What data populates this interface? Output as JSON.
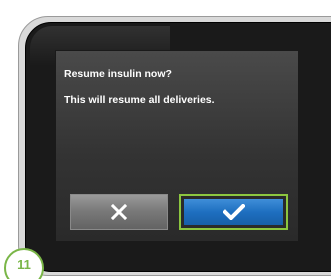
{
  "dialog": {
    "title": "Resume insulin now?",
    "message": "This will resume all deliveries."
  },
  "buttons": {
    "cancel_icon": "close-icon",
    "confirm_icon": "checkmark-icon"
  },
  "step": {
    "number": "11"
  },
  "colors": {
    "confirm_button": "#1e6fc0",
    "confirm_highlight": "#8cc63f",
    "step_badge": "#7ab648",
    "screen_background": "#3a3a3a"
  }
}
